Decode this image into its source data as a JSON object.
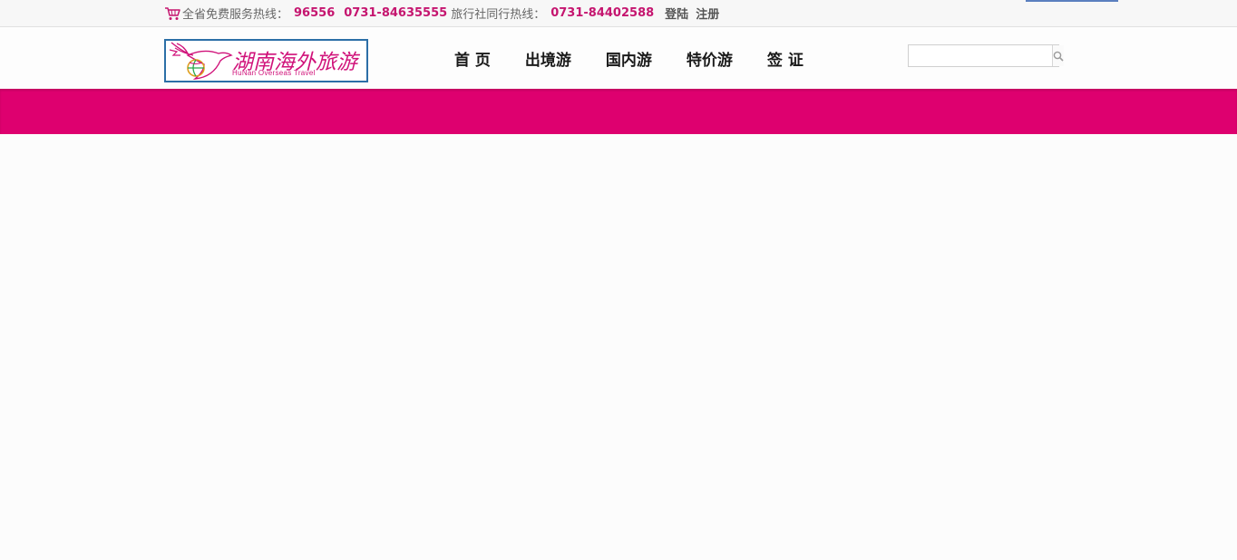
{
  "topbar": {
    "hotline_label": "全省免费服务热线：",
    "hotline_short": "96556",
    "hotline_number": "0731-84635555",
    "agency_label": "旅行社同行热线：",
    "agency_number": "0731-84402588",
    "login": "登陆",
    "register": "注册"
  },
  "logo": {
    "title": "湖南海外旅游",
    "subtitle": "HuNan Overseas Travel"
  },
  "nav": {
    "items": [
      {
        "label": "首 页"
      },
      {
        "label": "出境游"
      },
      {
        "label": "国内游"
      },
      {
        "label": "特价游"
      },
      {
        "label": "签 证"
      }
    ]
  },
  "search": {
    "value": "",
    "placeholder": ""
  },
  "colors": {
    "accent": "#de006f",
    "highlight_text": "#c5156f",
    "logo_border": "#2c6fa7"
  },
  "icons": {
    "cart": "shopping-cart-icon",
    "search": "magnifier-icon",
    "logo": "dove-globe-icon"
  }
}
